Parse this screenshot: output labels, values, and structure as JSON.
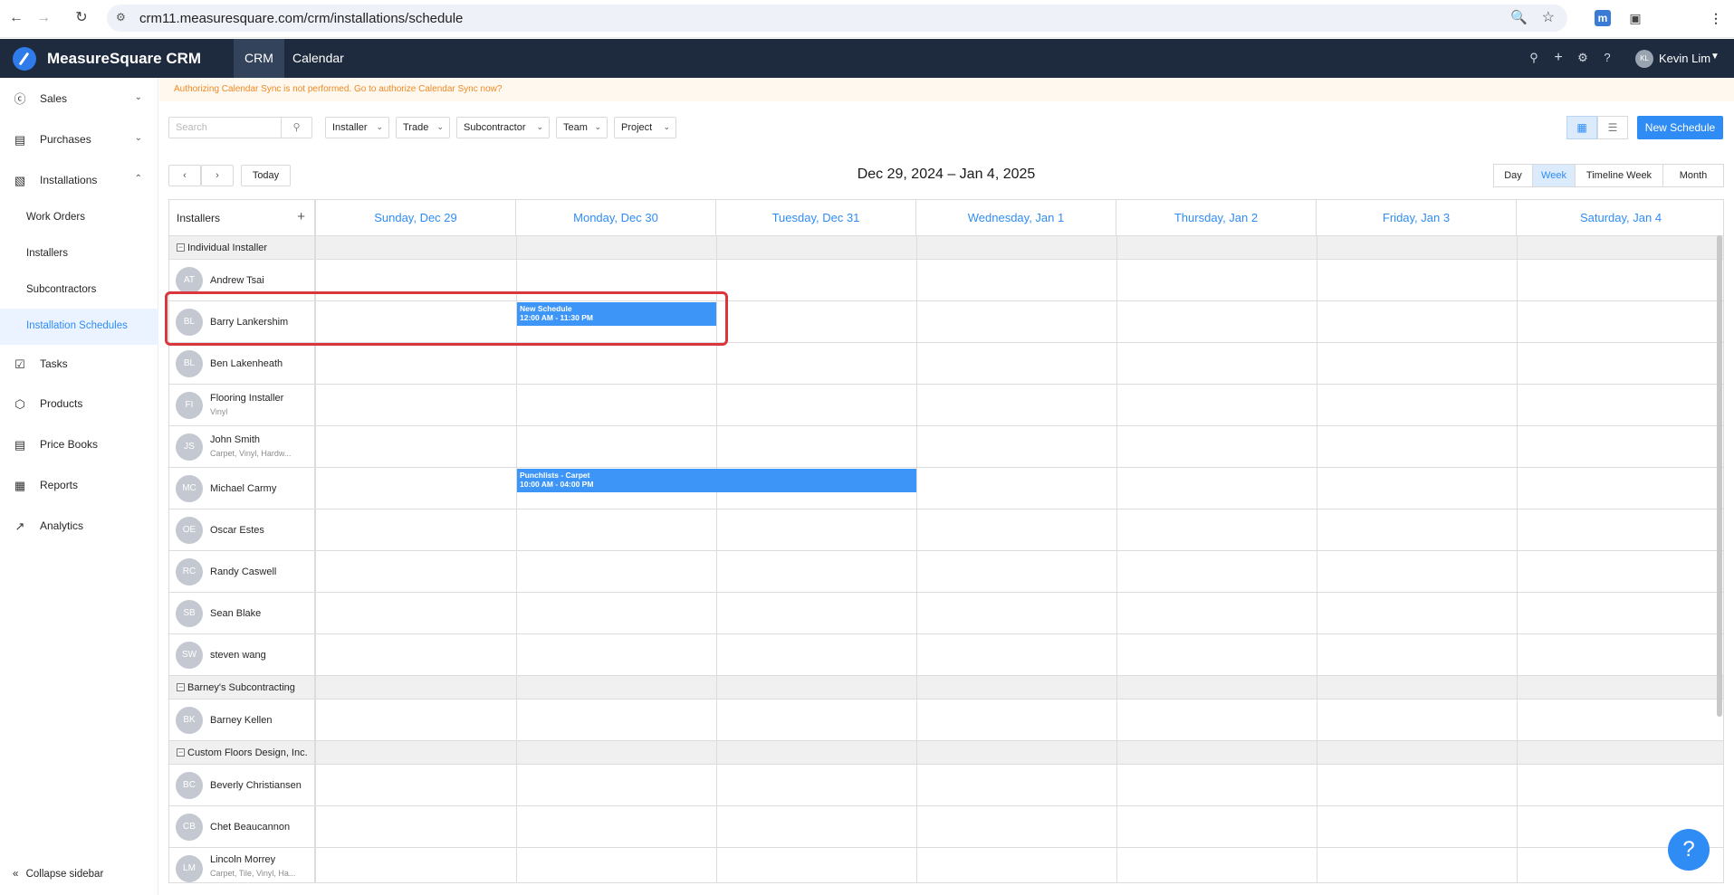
{
  "browser": {
    "url": "crm11.measuresquare.com/crm/installations/schedule"
  },
  "app": {
    "name": "MeasureSquare CRM",
    "tabs": [
      "CRM",
      "Calendar"
    ],
    "user": {
      "initials": "KL",
      "name": "Kevin Lim"
    }
  },
  "sidebar": {
    "items": [
      {
        "label": "Sales",
        "icon": "dollar-circle-icon"
      },
      {
        "label": "Purchases",
        "icon": "purchase-icon"
      },
      {
        "label": "Installations",
        "icon": "installation-icon"
      },
      {
        "label": "Tasks",
        "icon": "calendar-check-icon"
      },
      {
        "label": "Products",
        "icon": "box-icon"
      },
      {
        "label": "Price Books",
        "icon": "book-icon"
      },
      {
        "label": "Reports",
        "icon": "presentation-icon"
      },
      {
        "label": "Analytics",
        "icon": "line-chart-icon"
      }
    ],
    "installation_subitems": [
      "Work Orders",
      "Installers",
      "Subcontractors",
      "Installation Schedules"
    ],
    "collapse_label": "Collapse sidebar"
  },
  "banner": {
    "text": "Authorizing Calendar Sync is not performed. Go to authorize Calendar Sync now?"
  },
  "toolbar": {
    "search_placeholder": "Search",
    "filters": [
      "Installer",
      "Trade",
      "Subcontractor",
      "Team",
      "Project"
    ],
    "new_schedule_label": "New Schedule"
  },
  "calendar_nav": {
    "today_label": "Today",
    "range_title": "Dec 29, 2024 – Jan 4, 2025",
    "modes": [
      "Day",
      "Week",
      "Timeline Week",
      "Month"
    ],
    "active_mode": "Week"
  },
  "calendar": {
    "installers_header": "Installers",
    "days": [
      "Sunday, Dec 29",
      "Monday, Dec 30",
      "Tuesday, Dec 31",
      "Wednesday, Jan 1",
      "Thursday, Jan 2",
      "Friday, Jan 3",
      "Saturday, Jan 4"
    ],
    "groups": [
      {
        "name": "Individual Installer",
        "installers": [
          {
            "initials": "AT",
            "name": "Andrew Tsai",
            "trade": ""
          },
          {
            "initials": "BL",
            "name": "Barry Lankershim",
            "trade": ""
          },
          {
            "initials": "BL",
            "name": "Ben Lakenheath",
            "trade": ""
          },
          {
            "initials": "FI",
            "name": "Flooring Installer",
            "trade": "Vinyl"
          },
          {
            "initials": "JS",
            "name": "John Smith",
            "trade": "Carpet, Vinyl, Hardw..."
          },
          {
            "initials": "MC",
            "name": "Michael Carmy",
            "trade": ""
          },
          {
            "initials": "OE",
            "name": "Oscar Estes",
            "trade": ""
          },
          {
            "initials": "RC",
            "name": "Randy Caswell",
            "trade": ""
          },
          {
            "initials": "SB",
            "name": "Sean Blake",
            "trade": ""
          },
          {
            "initials": "SW",
            "name": "steven wang",
            "trade": ""
          }
        ]
      },
      {
        "name": "Barney's Subcontracting",
        "installers": [
          {
            "initials": "BK",
            "name": "Barney Kellen",
            "trade": ""
          }
        ]
      },
      {
        "name": "Custom Floors Design, Inc.",
        "installers": [
          {
            "initials": "BC",
            "name": "Beverly Christiansen",
            "trade": ""
          },
          {
            "initials": "CB",
            "name": "Chet Beaucannon",
            "trade": ""
          },
          {
            "initials": "LM",
            "name": "Lincoln Morrey",
            "trade": "Carpet, Tile, Vinyl, Ha..."
          }
        ]
      }
    ],
    "events": [
      {
        "title": "New Schedule",
        "time": "12:00 AM - 11:30 PM",
        "installer": "Barry Lankershim",
        "day": "Monday, Dec 30"
      },
      {
        "title": "Punchlists - Carpet",
        "time": "10:00 AM - 04:00 PM",
        "installer": "Michael Carmy",
        "day": "Monday, Dec 30 – Tuesday, Dec 31"
      }
    ]
  },
  "colors": {
    "nav_bg": "#1e2a3e",
    "accent": "#2f8cf5",
    "event": "#3d96f7",
    "highlight": "#d9363e",
    "banner_text": "#f08a24"
  }
}
